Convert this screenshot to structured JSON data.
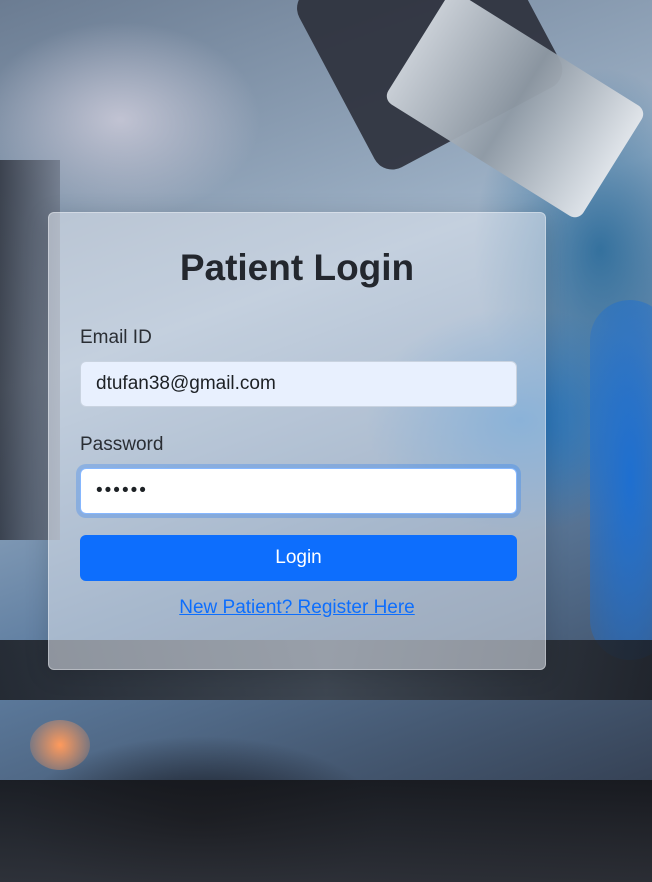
{
  "background": {
    "description_icon": "microscope-background-image"
  },
  "login": {
    "title": "Patient Login",
    "email": {
      "label": "Email ID",
      "value": "dtufan38@gmail.com"
    },
    "password": {
      "label": "Password",
      "value": "••••••"
    },
    "submit_label": "Login",
    "register_link": "New Patient? Register Here"
  },
  "colors": {
    "primary": "#0d6efd",
    "title": "#23272e",
    "email_bg": "#e8f0fe"
  }
}
